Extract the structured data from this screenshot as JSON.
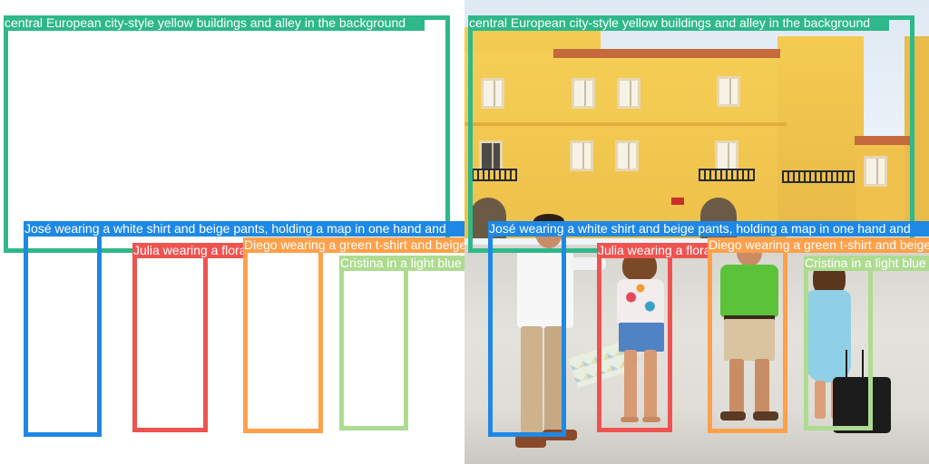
{
  "colors": {
    "scene": "#2fb88a",
    "jose": "#1e88e5",
    "julia": "#ef5350",
    "diego": "#ffa04a",
    "cristina": "#addc91"
  },
  "annotations": {
    "scene": "central European city-style yellow buildings and alley in the background",
    "jose": "José wearing a white shirt and beige pants, holding a map in one hand and",
    "julia": "Julia wearing a floral shirt and blue denim shorts, holding a coffee cup",
    "diego": "Diego wearing a green t-shirt and beige shorts",
    "cristina": "Cristina in a light blue dress"
  }
}
